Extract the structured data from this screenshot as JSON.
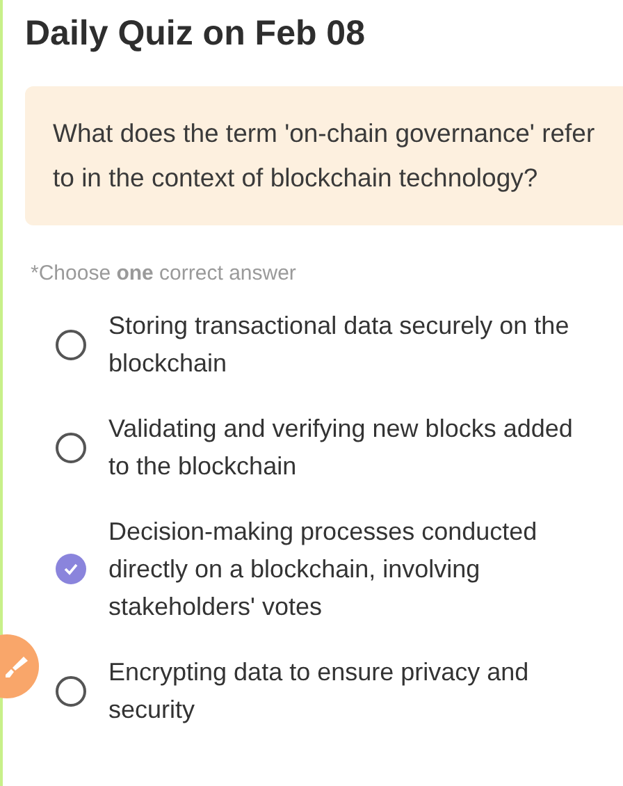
{
  "title": "Daily Quiz on Feb 08",
  "question": "What does the term 'on-chain governance' refer to in the context of blockchain technology?",
  "instruction": "*Choose **one** correct answer",
  "options": [
    {
      "text": "Storing transactional data securely on the blockchain",
      "selected": false
    },
    {
      "text": "Validating and verifying new blocks added to the blockchain",
      "selected": false
    },
    {
      "text": "Decision-making processes conducted directly on a blockchain, involving stakeholders' votes",
      "selected": true
    },
    {
      "text": "Encrypting data to ensure privacy and security",
      "selected": false
    }
  ]
}
